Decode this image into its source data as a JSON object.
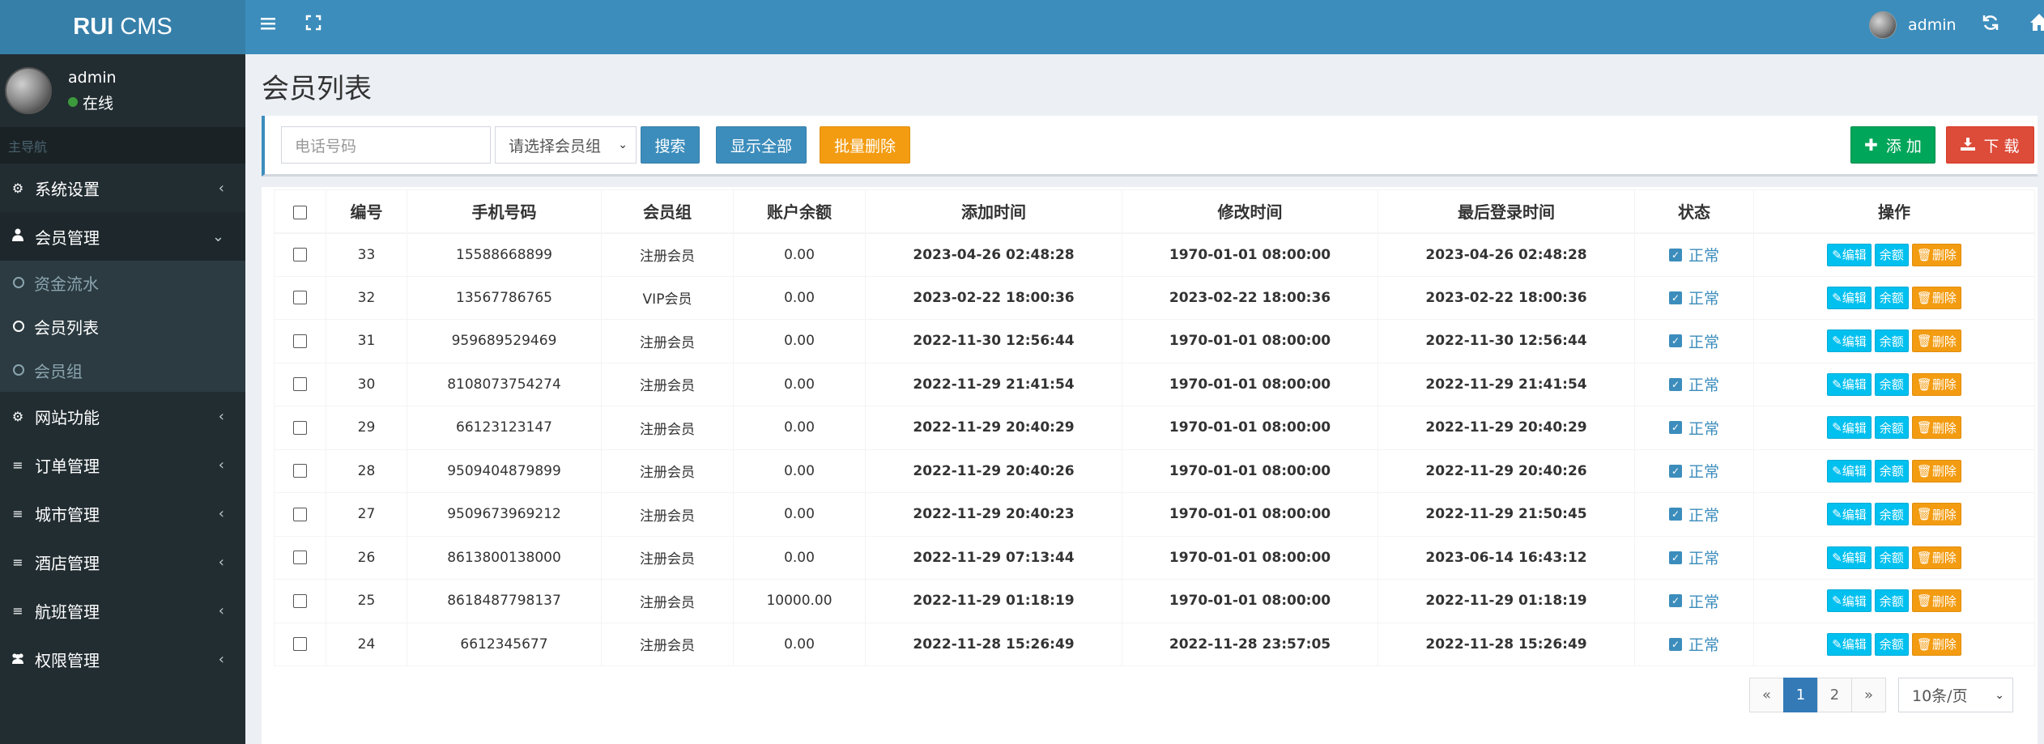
{
  "sidebar": {
    "logo_bold": "RUI",
    "logo_rest": "CMS",
    "user_name": "admin",
    "user_status": "在线",
    "nav_header": "主导航",
    "menu": [
      {
        "label": "系统设置",
        "icon": "cogs-icon"
      },
      {
        "label": "会员管理",
        "icon": "user-icon"
      },
      {
        "label": "网站功能",
        "icon": "gear-icon"
      },
      {
        "label": "订单管理",
        "icon": "list-icon"
      },
      {
        "label": "城市管理",
        "icon": "list-icon"
      },
      {
        "label": "酒店管理",
        "icon": "list-icon"
      },
      {
        "label": "航班管理",
        "icon": "list-icon"
      },
      {
        "label": "权限管理",
        "icon": "users-icon"
      }
    ],
    "submenu": [
      "资金流水",
      "会员列表",
      "会员组"
    ]
  },
  "topbar": {
    "user_name": "admin"
  },
  "page_title": "会员列表",
  "search": {
    "phone_placeholder": "电话号码",
    "group_select": "请选择会员组",
    "search_label": "搜索",
    "show_all_label": "显示全部",
    "batch_delete_label": "批量删除",
    "add_label": "添 加",
    "download_label": "下 载"
  },
  "table": {
    "headers": [
      "编号",
      "手机号码",
      "会员组",
      "账户余额",
      "添加时间",
      "修改时间",
      "最后登录时间",
      "状态",
      "操作"
    ],
    "status_label": "正常",
    "op_edit": "编辑",
    "op_balance": "余额",
    "op_delete": "删除",
    "rows": [
      {
        "id": "33",
        "phone": "15588668899",
        "group": "注册会员",
        "balance": "0.00",
        "added": "2023-04-26 02:48:28",
        "modified": "1970-01-01 08:00:00",
        "last_login": "2023-04-26 02:48:28"
      },
      {
        "id": "32",
        "phone": "13567786765",
        "group": "VIP会员",
        "balance": "0.00",
        "added": "2023-02-22 18:00:36",
        "modified": "2023-02-22 18:00:36",
        "last_login": "2023-02-22 18:00:36"
      },
      {
        "id": "31",
        "phone": "959689529469",
        "group": "注册会员",
        "balance": "0.00",
        "added": "2022-11-30 12:56:44",
        "modified": "1970-01-01 08:00:00",
        "last_login": "2022-11-30 12:56:44"
      },
      {
        "id": "30",
        "phone": "8108073754274",
        "group": "注册会员",
        "balance": "0.00",
        "added": "2022-11-29 21:41:54",
        "modified": "1970-01-01 08:00:00",
        "last_login": "2022-11-29 21:41:54"
      },
      {
        "id": "29",
        "phone": "66123123147",
        "group": "注册会员",
        "balance": "0.00",
        "added": "2022-11-29 20:40:29",
        "modified": "1970-01-01 08:00:00",
        "last_login": "2022-11-29 20:40:29"
      },
      {
        "id": "28",
        "phone": "9509404879899",
        "group": "注册会员",
        "balance": "0.00",
        "added": "2022-11-29 20:40:26",
        "modified": "1970-01-01 08:00:00",
        "last_login": "2022-11-29 20:40:26"
      },
      {
        "id": "27",
        "phone": "9509673969212",
        "group": "注册会员",
        "balance": "0.00",
        "added": "2022-11-29 20:40:23",
        "modified": "1970-01-01 08:00:00",
        "last_login": "2022-11-29 21:50:45"
      },
      {
        "id": "26",
        "phone": "8613800138000",
        "group": "注册会员",
        "balance": "0.00",
        "added": "2022-11-29 07:13:44",
        "modified": "1970-01-01 08:00:00",
        "last_login": "2023-06-14 16:43:12"
      },
      {
        "id": "25",
        "phone": "8618487798137",
        "group": "注册会员",
        "balance": "10000.00",
        "added": "2022-11-29 01:18:19",
        "modified": "1970-01-01 08:00:00",
        "last_login": "2022-11-29 01:18:19"
      },
      {
        "id": "24",
        "phone": "6612345677",
        "group": "注册会员",
        "balance": "0.00",
        "added": "2022-11-28 15:26:49",
        "modified": "2022-11-28 23:57:05",
        "last_login": "2022-11-28 15:26:49"
      }
    ]
  },
  "pagination": {
    "prev": "«",
    "pages": [
      "1",
      "2"
    ],
    "next": "»",
    "page_size": "10条/页"
  },
  "colors": {
    "brand": "#3c8dbc",
    "sidebar": "#222d32",
    "success": "#00a65a",
    "danger": "#dd4b39",
    "warning": "#f39c12",
    "info": "#00c0ef"
  }
}
